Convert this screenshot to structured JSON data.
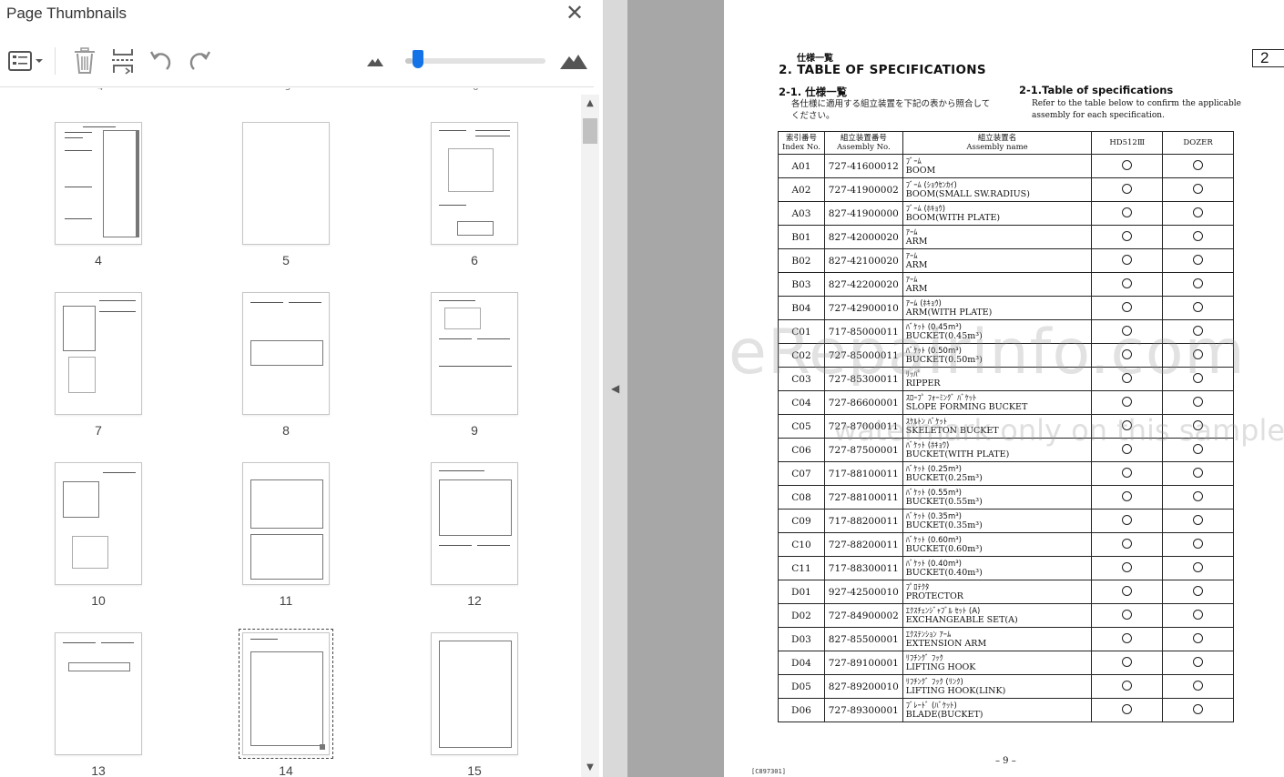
{
  "panel": {
    "title": "Page Thumbnails",
    "close_label": "✕",
    "toolbar": {
      "options_icon": "options-menu-icon",
      "delete_icon": "trash-icon",
      "insert_icon": "insert-pages-icon",
      "rotate_ccw_icon": "rotate-counterclockwise-icon",
      "rotate_cw_icon": "rotate-clockwise-icon",
      "zoom_out_icon": "small-mountain-icon",
      "zoom_in_icon": "large-mountain-icon",
      "zoom_level": 0.05
    },
    "prev_labels": [
      "4",
      "5",
      "6"
    ],
    "selected_page": "14",
    "thumbnails": [
      "4",
      "5",
      "6",
      "7",
      "8",
      "9",
      "10",
      "11",
      "12",
      "13",
      "14",
      "15"
    ]
  },
  "colors": {
    "accent": "#1473e6",
    "gutter": "#a7a7a7"
  },
  "document": {
    "jp_heading": "仕様一覧",
    "title": "2.  TABLE OF SPECIFICATIONS",
    "page_tab": "2",
    "sub_jp": "2-1. 仕様一覧",
    "desc_jp": "各仕様に適用する組立装置を下記の表から照合してください。",
    "sub_en": "2-1.Table of specifications",
    "desc_en": "Refer to the table below to confirm the applicable assembly for each specification.",
    "table": {
      "headers": {
        "index_jp": "索引番号",
        "index_en": "Index No.",
        "assembly_jp": "組立装置番号",
        "assembly_en": "Assembly No.",
        "name_jp": "組立装置名",
        "name_en": "Assembly name",
        "model1": "HD512Ⅲ",
        "model2": "DOZER"
      },
      "rows": [
        {
          "idx": "A01",
          "asm": "727-41600012",
          "jp": "ﾌﾞｰﾑ",
          "en": "BOOM"
        },
        {
          "idx": "A02",
          "asm": "727-41900002",
          "jp": "ﾌﾞｰﾑ (ｼｮｳｾﾝｶｲ)",
          "en": "BOOM(SMALL SW.RADIUS)"
        },
        {
          "idx": "A03",
          "asm": "827-41900000",
          "jp": "ﾌﾞｰﾑ (ﾎｷｮｳ)",
          "en": "BOOM(WITH PLATE)"
        },
        {
          "idx": "B01",
          "asm": "827-42000020",
          "jp": "ｱｰﾑ",
          "en": "ARM"
        },
        {
          "idx": "B02",
          "asm": "827-42100020",
          "jp": "ｱｰﾑ",
          "en": "ARM"
        },
        {
          "idx": "B03",
          "asm": "827-42200020",
          "jp": "ｱｰﾑ",
          "en": "ARM"
        },
        {
          "idx": "B04",
          "asm": "727-42900010",
          "jp": "ｱｰﾑ (ﾎｷｮｳ)",
          "en": "ARM(WITH PLATE)"
        },
        {
          "idx": "C01",
          "asm": "717-85000011",
          "jp": "ﾊﾞｹｯﾄ (0.45m³)",
          "en": "BUCKET(0.45m³)"
        },
        {
          "idx": "C02",
          "asm": "727-85000011",
          "jp": "ﾊﾞｹｯﾄ (0.50m³)",
          "en": "BUCKET(0.50m³)"
        },
        {
          "idx": "C03",
          "asm": "727-85300011",
          "jp": "ﾘｯﾊﾟ",
          "en": "RIPPER"
        },
        {
          "idx": "C04",
          "asm": "727-86600001",
          "jp": "ｽﾛｰﾌﾟ ﾌｫｰﾐﾝｸﾞ ﾊﾞｹｯﾄ",
          "en": "SLOPE FORMING BUCKET"
        },
        {
          "idx": "C05",
          "asm": "727-87000011",
          "jp": "ｽｹﾙﾄﾝ ﾊﾞｹｯﾄ",
          "en": "SKELETON BUCKET"
        },
        {
          "idx": "C06",
          "asm": "727-87500001",
          "jp": "ﾊﾞｹｯﾄ (ﾎｷｮｳ)",
          "en": "BUCKET(WITH PLATE)"
        },
        {
          "idx": "C07",
          "asm": "717-88100011",
          "jp": "ﾊﾞｹｯﾄ (0.25m³)",
          "en": "BUCKET(0.25m³)"
        },
        {
          "idx": "C08",
          "asm": "727-88100011",
          "jp": "ﾊﾞｹｯﾄ (0.55m³)",
          "en": "BUCKET(0.55m³)"
        },
        {
          "idx": "C09",
          "asm": "717-88200011",
          "jp": "ﾊﾞｹｯﾄ (0.35m³)",
          "en": "BUCKET(0.35m³)"
        },
        {
          "idx": "C10",
          "asm": "727-88200011",
          "jp": "ﾊﾞｹｯﾄ (0.60m³)",
          "en": "BUCKET(0.60m³)"
        },
        {
          "idx": "C11",
          "asm": "717-88300011",
          "jp": "ﾊﾞｹｯﾄ (0.40m³)",
          "en": "BUCKET(0.40m³)"
        },
        {
          "idx": "D01",
          "asm": "927-42500010",
          "jp": "ﾌﾟﾛﾃｸﾀ",
          "en": "PROTECTOR"
        },
        {
          "idx": "D02",
          "asm": "727-84900002",
          "jp": "ｴｸｽﾁｪﾝｼﾞｬﾌﾞﾙ ｾｯﾄ (A)",
          "en": "EXCHANGEABLE SET(A)"
        },
        {
          "idx": "D03",
          "asm": "827-85500001",
          "jp": "ｴｸｽﾃﾝｼｮﾝ ｱｰﾑ",
          "en": "EXTENSION ARM"
        },
        {
          "idx": "D04",
          "asm": "727-89100001",
          "jp": "ﾘﾌﾁﾝｸﾞ ﾌｯｸ",
          "en": "LIFTING HOOK"
        },
        {
          "idx": "D05",
          "asm": "827-89200010",
          "jp": "ﾘﾌﾁﾝｸﾞ ﾌｯｸ (ﾘﾝｸ)",
          "en": "LIFTING HOOK(LINK)"
        },
        {
          "idx": "D06",
          "asm": "727-89300001",
          "jp": "ﾌﾞﾚｰﾄﾞ (ﾊﾞｹｯﾄ)",
          "en": "BLADE(BUCKET)"
        }
      ]
    },
    "footer": "– 9 –",
    "code": "[C897301]",
    "watermark_main": "eRepairinfo.com",
    "watermark_sub": "watermark only on this sample"
  }
}
